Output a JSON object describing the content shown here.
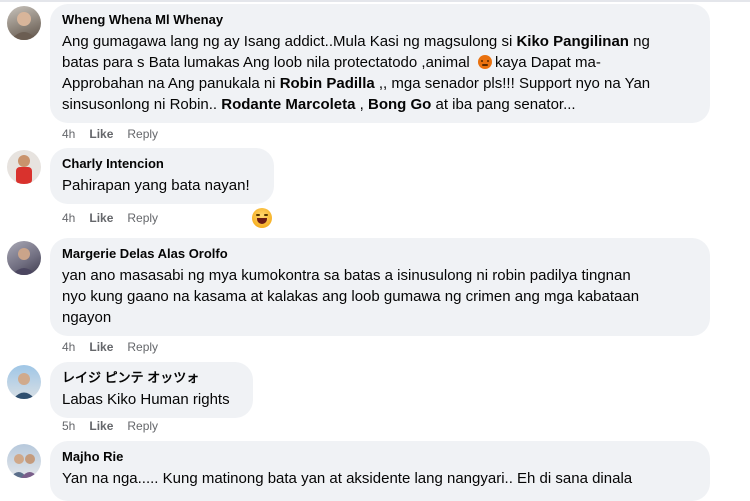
{
  "comments": [
    {
      "name": "Wheng Whena Ml Whenay",
      "line1": "Ang gumagawa lang ng ay Isang addict..Mula Kasi ng magsulong si ",
      "bold1": "Kiko Pangilinan",
      "line1b": " ng",
      "line2": "batas para s Bata lumakas Ang loob nila protectatodo ,animal",
      "line2b": "kaya Dapat ma-",
      "line3a": "Approbahan na Ang panukala ni ",
      "bold2": "Robin Padilla",
      "line3b": " ,, mga senador pls!!! Support nyo na Yan",
      "line4a": "sinsusonlong ni Robin.. ",
      "bold3": "Rodante Marcoleta",
      "line4b": " , ",
      "bold4": "Bong Go",
      "line4c": " at iba pang senator...",
      "time": "4h",
      "like": "Like",
      "reply": "Reply"
    },
    {
      "name": "Charly Intencion",
      "text": "Pahirapan yang bata nayan!",
      "time": "4h",
      "like": "Like",
      "reply": "Reply"
    },
    {
      "name": "Margerie Delas Alas Orolfo",
      "line1": "yan ano masasabi ng mya kumokontra sa batas a isinusulong ni robin padilya tingnan",
      "line2": "nyo kung gaano na kasama at kalakas ang loob gumawa ng crimen ang mga kabataan",
      "line3": "ngayon",
      "time": "4h",
      "like": "Like",
      "reply": "Reply"
    },
    {
      "name": "レイジ ピンテ オッツォ",
      "text": "Labas Kiko Human rights",
      "time": "5h",
      "like": "Like",
      "reply": "Reply"
    },
    {
      "name": "Majho Rie",
      "text": "Yan na nga..... Kung matinong bata yan at aksidente lang nangyari.. Eh di sana dinala"
    }
  ],
  "colors": {
    "bubble": "#f0f2f5",
    "meta": "#65676b",
    "angry": "#e9710f",
    "haha": "#f7b125"
  }
}
